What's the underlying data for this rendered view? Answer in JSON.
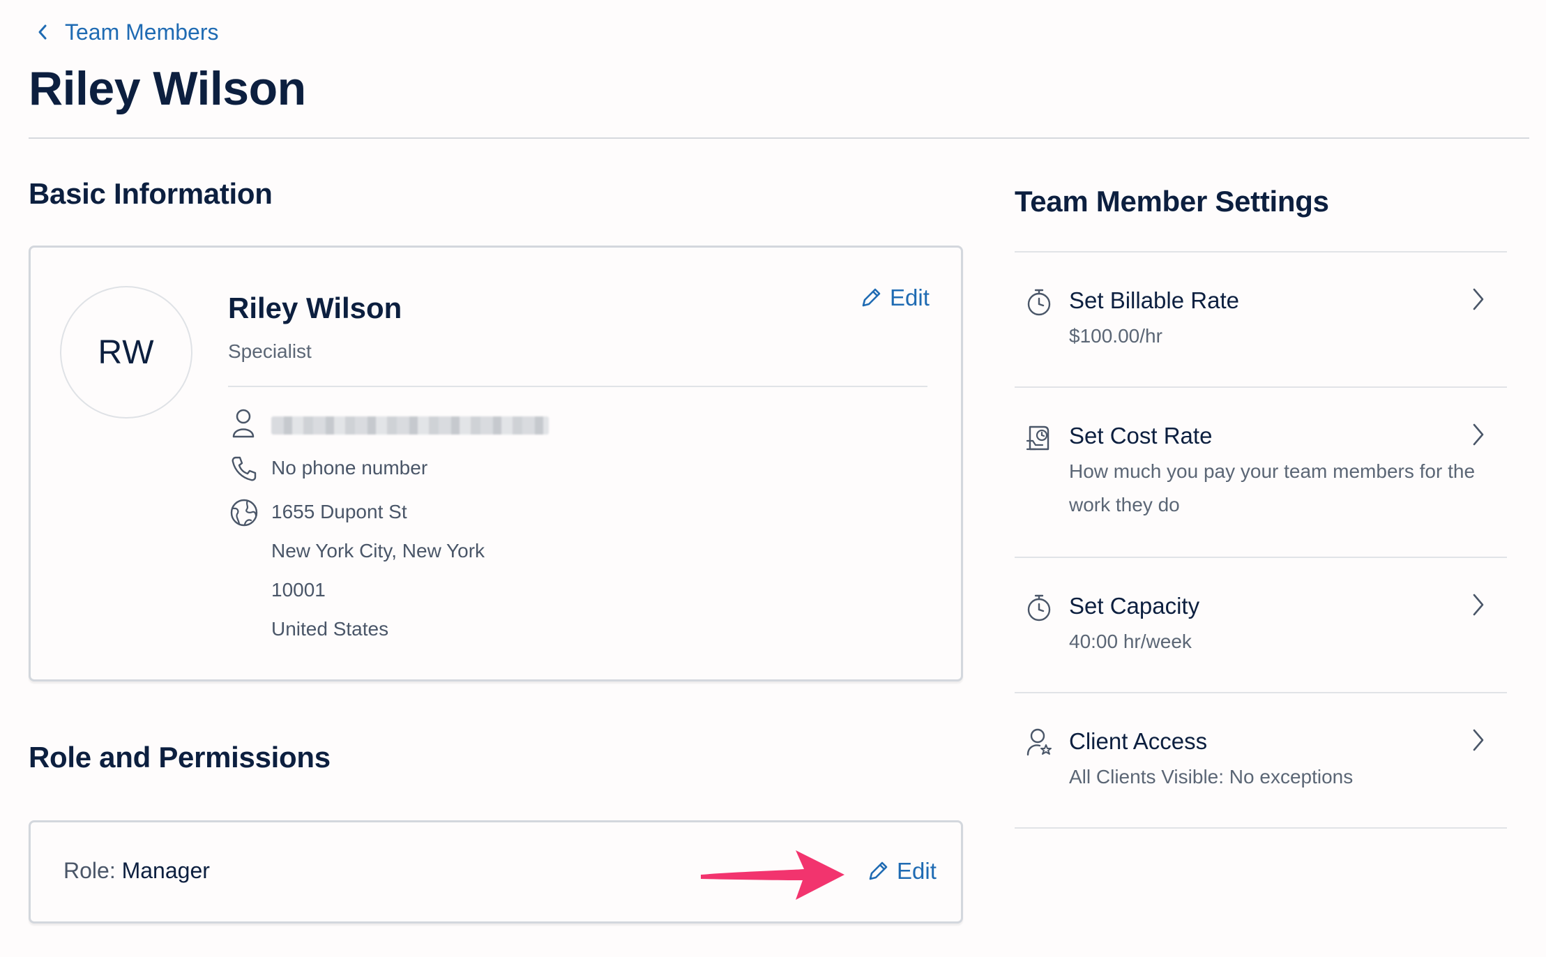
{
  "header": {
    "back_label": "Team Members",
    "title": "Riley Wilson"
  },
  "basic_info": {
    "section_title": "Basic Information",
    "avatar_initials": "RW",
    "name": "Riley Wilson",
    "job_title": "Specialist",
    "edit_label": "Edit",
    "phone": "No phone number",
    "address": {
      "street": "1655 Dupont St",
      "city_state": "New York City, New York",
      "zip": "10001",
      "country": "United States"
    }
  },
  "role": {
    "section_title": "Role and Permissions",
    "role_label": "Role:",
    "role_value": "Manager",
    "edit_label": "Edit"
  },
  "settings": {
    "section_title": "Team Member Settings",
    "items": [
      {
        "icon": "stopwatch-icon",
        "title": "Set Billable Rate",
        "subtitle": "$100.00/hr"
      },
      {
        "icon": "cost-rate-icon",
        "title": "Set Cost Rate",
        "subtitle": "How much you pay your team members for the work they do"
      },
      {
        "icon": "stopwatch-icon",
        "title": "Set Capacity",
        "subtitle": "40:00 hr/week"
      },
      {
        "icon": "client-access-icon",
        "title": "Client Access",
        "subtitle": "All Clients Visible: No exceptions"
      }
    ]
  },
  "colors": {
    "link": "#1f6bb3",
    "heading": "#0c1f3f",
    "annotation_arrow": "#f2346e"
  }
}
